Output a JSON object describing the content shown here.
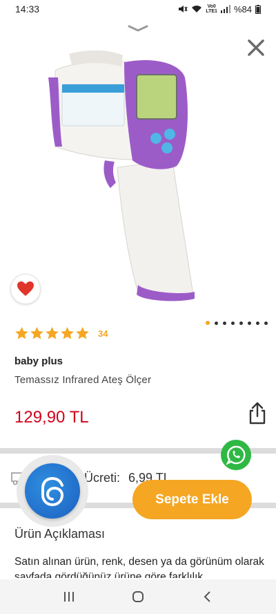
{
  "status_bar": {
    "time": "14:33",
    "network": "Vo0\nLTE1",
    "battery": "%84"
  },
  "product": {
    "brand": "baby plus",
    "name": "Temassız Infrared Ateş Ölçer",
    "price": "129,90 TL",
    "rating_stars": 5,
    "rating_count": "34",
    "image_count": 8,
    "active_image": 1
  },
  "shipping": {
    "label": "Ücreti:",
    "value": "6,99 TL"
  },
  "description": {
    "title": "Ürün Açıklaması",
    "text": "Satın alınan ürün, renk, desen ya da görünüm olarak sayfada gördüğünüz ürüne göre farklılık"
  },
  "actions": {
    "add_to_cart": "Sepete Ekle"
  },
  "colors": {
    "accent": "#f5a623",
    "price": "#d0021b",
    "whatsapp": "#2fb844",
    "favorite": "#e0352b",
    "assistant": "#1c5fbf"
  },
  "icons": {
    "close": "close-icon",
    "collapse": "chevron-down-icon",
    "favorite": "heart-icon",
    "share": "share-icon",
    "whatsapp": "whatsapp-icon",
    "assistant": "assistant-icon",
    "shipping": "truck-icon"
  }
}
